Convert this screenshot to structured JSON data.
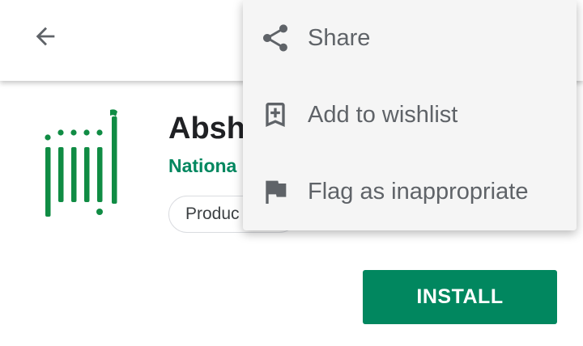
{
  "toolbar": {
    "back_icon": "arrow-back-icon"
  },
  "app": {
    "title": "Absh",
    "developer": "Nationa",
    "chip_label": "Produc",
    "install_label": "INSTALL",
    "brand_color": "#01875f"
  },
  "menu": {
    "items": [
      {
        "label": "Share",
        "icon": "share-icon"
      },
      {
        "label": "Add to wishlist",
        "icon": "bookmark-add-icon"
      },
      {
        "label": "Flag as inappropriate",
        "icon": "flag-icon"
      }
    ]
  }
}
